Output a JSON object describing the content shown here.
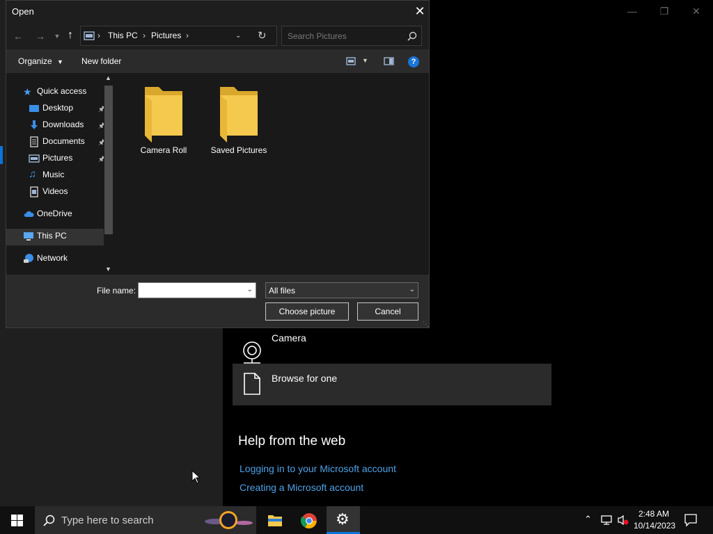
{
  "background": {
    "options": [
      {
        "label": "Camera",
        "icon": "camera-icon"
      },
      {
        "label": "Browse for one",
        "icon": "file-icon"
      }
    ],
    "help_title": "Help from the web",
    "links": [
      "Logging in to your Microsoft account",
      "Creating a Microsoft account"
    ]
  },
  "dialog": {
    "title": "Open",
    "address": [
      "This PC",
      "Pictures"
    ],
    "search_placeholder": "Search Pictures",
    "toolbar": {
      "organize": "Organize",
      "new_folder": "New folder"
    },
    "nav": {
      "quick_access": "Quick access",
      "pinned": [
        "Desktop",
        "Downloads",
        "Documents",
        "Pictures"
      ],
      "others": [
        "Music",
        "Videos"
      ],
      "onedrive": "OneDrive",
      "this_pc": "This PC",
      "network": "Network"
    },
    "folders": [
      "Camera Roll",
      "Saved Pictures"
    ],
    "file_name_label": "File name:",
    "file_name_value": "",
    "file_type": "All files",
    "choose_button": "Choose picture",
    "cancel_button": "Cancel"
  },
  "taskbar": {
    "search_placeholder": "Type here to search",
    "time": "2:48 AM",
    "date": "10/14/2023"
  },
  "colors": {
    "accent": "#0a74da",
    "link": "#4ea2e6",
    "folder": "#f5c94d"
  }
}
